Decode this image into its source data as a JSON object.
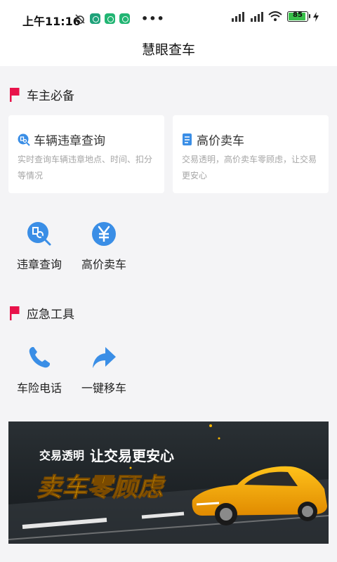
{
  "status_bar": {
    "time": "上午11:16",
    "battery": "85"
  },
  "header": {
    "title": "慧眼查车"
  },
  "owner_section": {
    "title": "车主必备",
    "cards": [
      {
        "title": "车辆违章查询",
        "desc": "实时查询车辆违章地点、时间、扣分等情况"
      },
      {
        "title": "高价卖车",
        "desc": "交易透明，高价卖车零顾虑，让交易更安心"
      }
    ],
    "shortcuts": [
      {
        "label": "违章查询",
        "icon": "search-ticket-icon"
      },
      {
        "label": "高价卖车",
        "icon": "yuan-icon"
      }
    ]
  },
  "emergency_section": {
    "title": "应急工具",
    "tools": [
      {
        "label": "车险电话",
        "icon": "phone-icon"
      },
      {
        "label": "一键移车",
        "icon": "arrow-share-icon"
      }
    ]
  },
  "banner": {
    "tagline_1": "交易透明",
    "tagline_2": "让交易更安心",
    "headline": "卖车零顾虑"
  },
  "colors": {
    "accent_blue": "#3a8ee6",
    "flag_red": "#e8124a",
    "banner_gold": "#f5b400"
  }
}
